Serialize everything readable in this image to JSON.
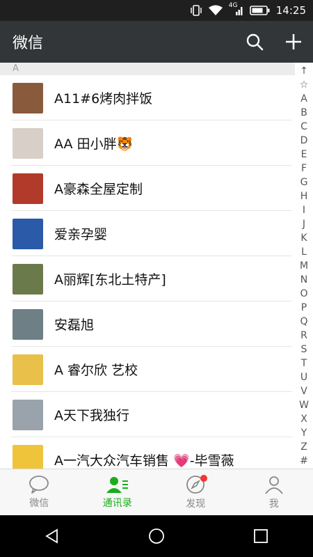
{
  "status_bar": {
    "network": "4G",
    "time": "14:25"
  },
  "app_bar": {
    "title": "微信"
  },
  "section_header": "A",
  "contacts": [
    {
      "name": "A11#6烤肉拌饭",
      "avatar_color": "#8a5a3c"
    },
    {
      "name": "AA 田小胖🐯",
      "avatar_color": "#d8cfc8"
    },
    {
      "name": "A豪森全屋定制",
      "avatar_color": "#b23a2a"
    },
    {
      "name": "爱亲孕婴",
      "avatar_color": "#2a5aa8"
    },
    {
      "name": "A丽辉[东北土特产]",
      "avatar_color": "#6b7a4a"
    },
    {
      "name": "安磊旭",
      "avatar_color": "#6e7f86"
    },
    {
      "name": "A  睿尔欣 艺校",
      "avatar_color": "#e9c04a"
    },
    {
      "name": "A天下我独行",
      "avatar_color": "#9aa3ab"
    },
    {
      "name": "A一汽大众汽车销售 💗-毕雪薇",
      "avatar_color": "#f0c43a"
    }
  ],
  "index_letters": [
    "↑",
    "☆",
    "A",
    "B",
    "C",
    "D",
    "E",
    "F",
    "G",
    "H",
    "I",
    "J",
    "K",
    "L",
    "M",
    "N",
    "O",
    "P",
    "Q",
    "R",
    "S",
    "T",
    "U",
    "V",
    "W",
    "X",
    "Y",
    "Z",
    "#"
  ],
  "tabs": [
    {
      "label": "微信",
      "icon": "chat-bubble-icon"
    },
    {
      "label": "通讯录",
      "icon": "contacts-icon"
    },
    {
      "label": "发现",
      "icon": "compass-icon"
    },
    {
      "label": "我",
      "icon": "person-icon"
    }
  ],
  "colors": {
    "accent": "#1aad19",
    "appbar": "#333638",
    "badge": "#f43530"
  }
}
